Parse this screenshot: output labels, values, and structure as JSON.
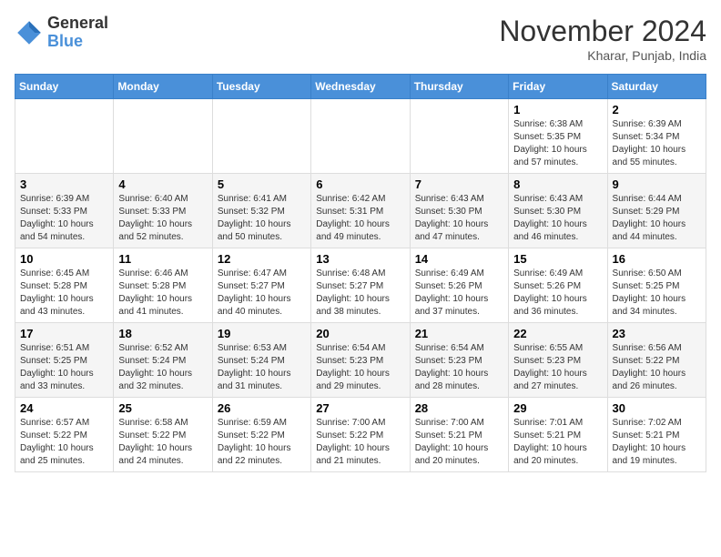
{
  "header": {
    "logo": {
      "line1": "General",
      "line2": "Blue"
    },
    "month": "November 2024",
    "location": "Kharar, Punjab, India"
  },
  "weekdays": [
    "Sunday",
    "Monday",
    "Tuesday",
    "Wednesday",
    "Thursday",
    "Friday",
    "Saturday"
  ],
  "weeks": [
    [
      {
        "day": "",
        "info": ""
      },
      {
        "day": "",
        "info": ""
      },
      {
        "day": "",
        "info": ""
      },
      {
        "day": "",
        "info": ""
      },
      {
        "day": "",
        "info": ""
      },
      {
        "day": "1",
        "info": "Sunrise: 6:38 AM\nSunset: 5:35 PM\nDaylight: 10 hours and 57 minutes."
      },
      {
        "day": "2",
        "info": "Sunrise: 6:39 AM\nSunset: 5:34 PM\nDaylight: 10 hours and 55 minutes."
      }
    ],
    [
      {
        "day": "3",
        "info": "Sunrise: 6:39 AM\nSunset: 5:33 PM\nDaylight: 10 hours and 54 minutes."
      },
      {
        "day": "4",
        "info": "Sunrise: 6:40 AM\nSunset: 5:33 PM\nDaylight: 10 hours and 52 minutes."
      },
      {
        "day": "5",
        "info": "Sunrise: 6:41 AM\nSunset: 5:32 PM\nDaylight: 10 hours and 50 minutes."
      },
      {
        "day": "6",
        "info": "Sunrise: 6:42 AM\nSunset: 5:31 PM\nDaylight: 10 hours and 49 minutes."
      },
      {
        "day": "7",
        "info": "Sunrise: 6:43 AM\nSunset: 5:30 PM\nDaylight: 10 hours and 47 minutes."
      },
      {
        "day": "8",
        "info": "Sunrise: 6:43 AM\nSunset: 5:30 PM\nDaylight: 10 hours and 46 minutes."
      },
      {
        "day": "9",
        "info": "Sunrise: 6:44 AM\nSunset: 5:29 PM\nDaylight: 10 hours and 44 minutes."
      }
    ],
    [
      {
        "day": "10",
        "info": "Sunrise: 6:45 AM\nSunset: 5:28 PM\nDaylight: 10 hours and 43 minutes."
      },
      {
        "day": "11",
        "info": "Sunrise: 6:46 AM\nSunset: 5:28 PM\nDaylight: 10 hours and 41 minutes."
      },
      {
        "day": "12",
        "info": "Sunrise: 6:47 AM\nSunset: 5:27 PM\nDaylight: 10 hours and 40 minutes."
      },
      {
        "day": "13",
        "info": "Sunrise: 6:48 AM\nSunset: 5:27 PM\nDaylight: 10 hours and 38 minutes."
      },
      {
        "day": "14",
        "info": "Sunrise: 6:49 AM\nSunset: 5:26 PM\nDaylight: 10 hours and 37 minutes."
      },
      {
        "day": "15",
        "info": "Sunrise: 6:49 AM\nSunset: 5:26 PM\nDaylight: 10 hours and 36 minutes."
      },
      {
        "day": "16",
        "info": "Sunrise: 6:50 AM\nSunset: 5:25 PM\nDaylight: 10 hours and 34 minutes."
      }
    ],
    [
      {
        "day": "17",
        "info": "Sunrise: 6:51 AM\nSunset: 5:25 PM\nDaylight: 10 hours and 33 minutes."
      },
      {
        "day": "18",
        "info": "Sunrise: 6:52 AM\nSunset: 5:24 PM\nDaylight: 10 hours and 32 minutes."
      },
      {
        "day": "19",
        "info": "Sunrise: 6:53 AM\nSunset: 5:24 PM\nDaylight: 10 hours and 31 minutes."
      },
      {
        "day": "20",
        "info": "Sunrise: 6:54 AM\nSunset: 5:23 PM\nDaylight: 10 hours and 29 minutes."
      },
      {
        "day": "21",
        "info": "Sunrise: 6:54 AM\nSunset: 5:23 PM\nDaylight: 10 hours and 28 minutes."
      },
      {
        "day": "22",
        "info": "Sunrise: 6:55 AM\nSunset: 5:23 PM\nDaylight: 10 hours and 27 minutes."
      },
      {
        "day": "23",
        "info": "Sunrise: 6:56 AM\nSunset: 5:22 PM\nDaylight: 10 hours and 26 minutes."
      }
    ],
    [
      {
        "day": "24",
        "info": "Sunrise: 6:57 AM\nSunset: 5:22 PM\nDaylight: 10 hours and 25 minutes."
      },
      {
        "day": "25",
        "info": "Sunrise: 6:58 AM\nSunset: 5:22 PM\nDaylight: 10 hours and 24 minutes."
      },
      {
        "day": "26",
        "info": "Sunrise: 6:59 AM\nSunset: 5:22 PM\nDaylight: 10 hours and 22 minutes."
      },
      {
        "day": "27",
        "info": "Sunrise: 7:00 AM\nSunset: 5:22 PM\nDaylight: 10 hours and 21 minutes."
      },
      {
        "day": "28",
        "info": "Sunrise: 7:00 AM\nSunset: 5:21 PM\nDaylight: 10 hours and 20 minutes."
      },
      {
        "day": "29",
        "info": "Sunrise: 7:01 AM\nSunset: 5:21 PM\nDaylight: 10 hours and 20 minutes."
      },
      {
        "day": "30",
        "info": "Sunrise: 7:02 AM\nSunset: 5:21 PM\nDaylight: 10 hours and 19 minutes."
      }
    ]
  ]
}
